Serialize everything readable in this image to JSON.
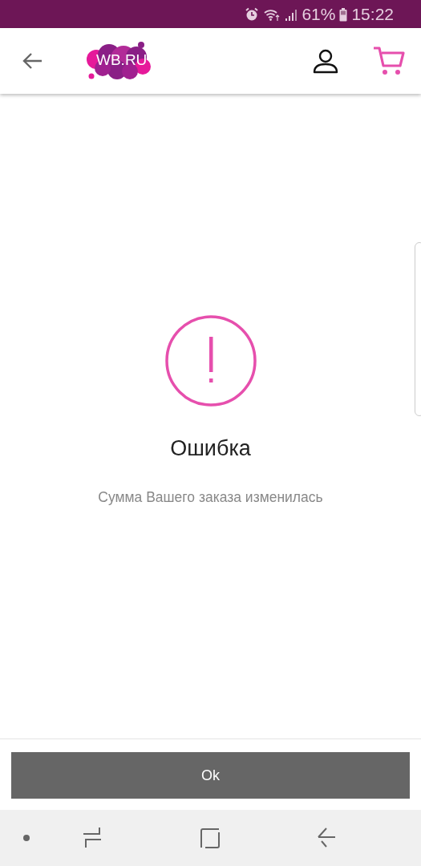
{
  "status_bar": {
    "battery": "61%",
    "time": "15:22"
  },
  "header": {
    "logo": "WB.RU"
  },
  "dialog": {
    "title": "Ошибка",
    "message": "Сумма Вашего заказа изменилась"
  },
  "buttons": [
    {
      "label": "Ok"
    }
  ]
}
